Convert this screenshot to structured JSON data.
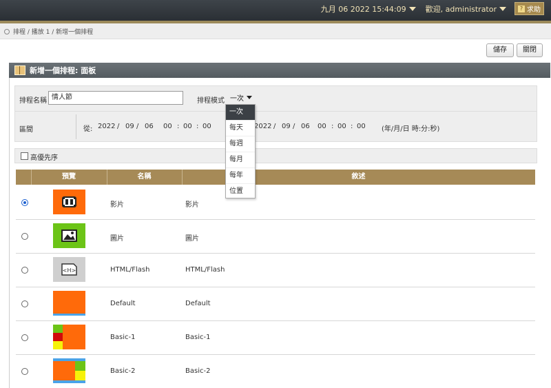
{
  "topbar": {
    "datetime": "九月 06 2022 15:44:09",
    "welcome": "歡迎, administrator",
    "help": "求助"
  },
  "breadcrumb": "排程 / 播放 1 / 新增一個排程",
  "toolbar": {
    "save": "儲存",
    "close": "關閉"
  },
  "panel": {
    "title": "新增一個排程: 面板"
  },
  "form": {
    "name_label": "排程名稱",
    "name_value": "情人節",
    "mode_label": "排程模式",
    "mode_value": "一次",
    "interval_label": "區間",
    "from_label": "從:",
    "from": {
      "year": "2022",
      "month": "09",
      "day": "06",
      "hh": "00",
      "mm": "00",
      "ss": "00"
    },
    "to": {
      "year": "2022",
      "month": "09",
      "day": "06",
      "hh": "00",
      "mm": "00",
      "ss": "00"
    },
    "format_hint": "(年/月/日 時:分:秒)"
  },
  "mode_options": [
    "一次",
    "每天",
    "每週",
    "每月",
    "每年",
    "位置"
  ],
  "priority_label": "高優先序",
  "table": {
    "headers": [
      "預覽",
      "名稱",
      "敘述"
    ],
    "rows": [
      {
        "name": "影片",
        "desc": "影片",
        "selected": true,
        "thumb": "video-icon"
      },
      {
        "name": "圖片",
        "desc": "圖片",
        "selected": false,
        "thumb": "image-icon"
      },
      {
        "name": "HTML/Flash",
        "desc": "HTML/Flash",
        "selected": false,
        "thumb": "html-icon"
      },
      {
        "name": "Default",
        "desc": "Default",
        "selected": false,
        "thumb": "layout-default"
      },
      {
        "name": "Basic-1",
        "desc": "Basic-1",
        "selected": false,
        "thumb": "layout-basic-1"
      },
      {
        "name": "Basic-2",
        "desc": "Basic-2",
        "selected": false,
        "thumb": "layout-basic-2"
      }
    ]
  },
  "colors": {
    "accent_gold": "#a68a57",
    "header_dark": "#545b60",
    "orange": "#ff6a0a",
    "green": "#6cc417",
    "yellow": "#f6f20a",
    "red": "#d10a0a",
    "blue": "#1a5fd0"
  }
}
